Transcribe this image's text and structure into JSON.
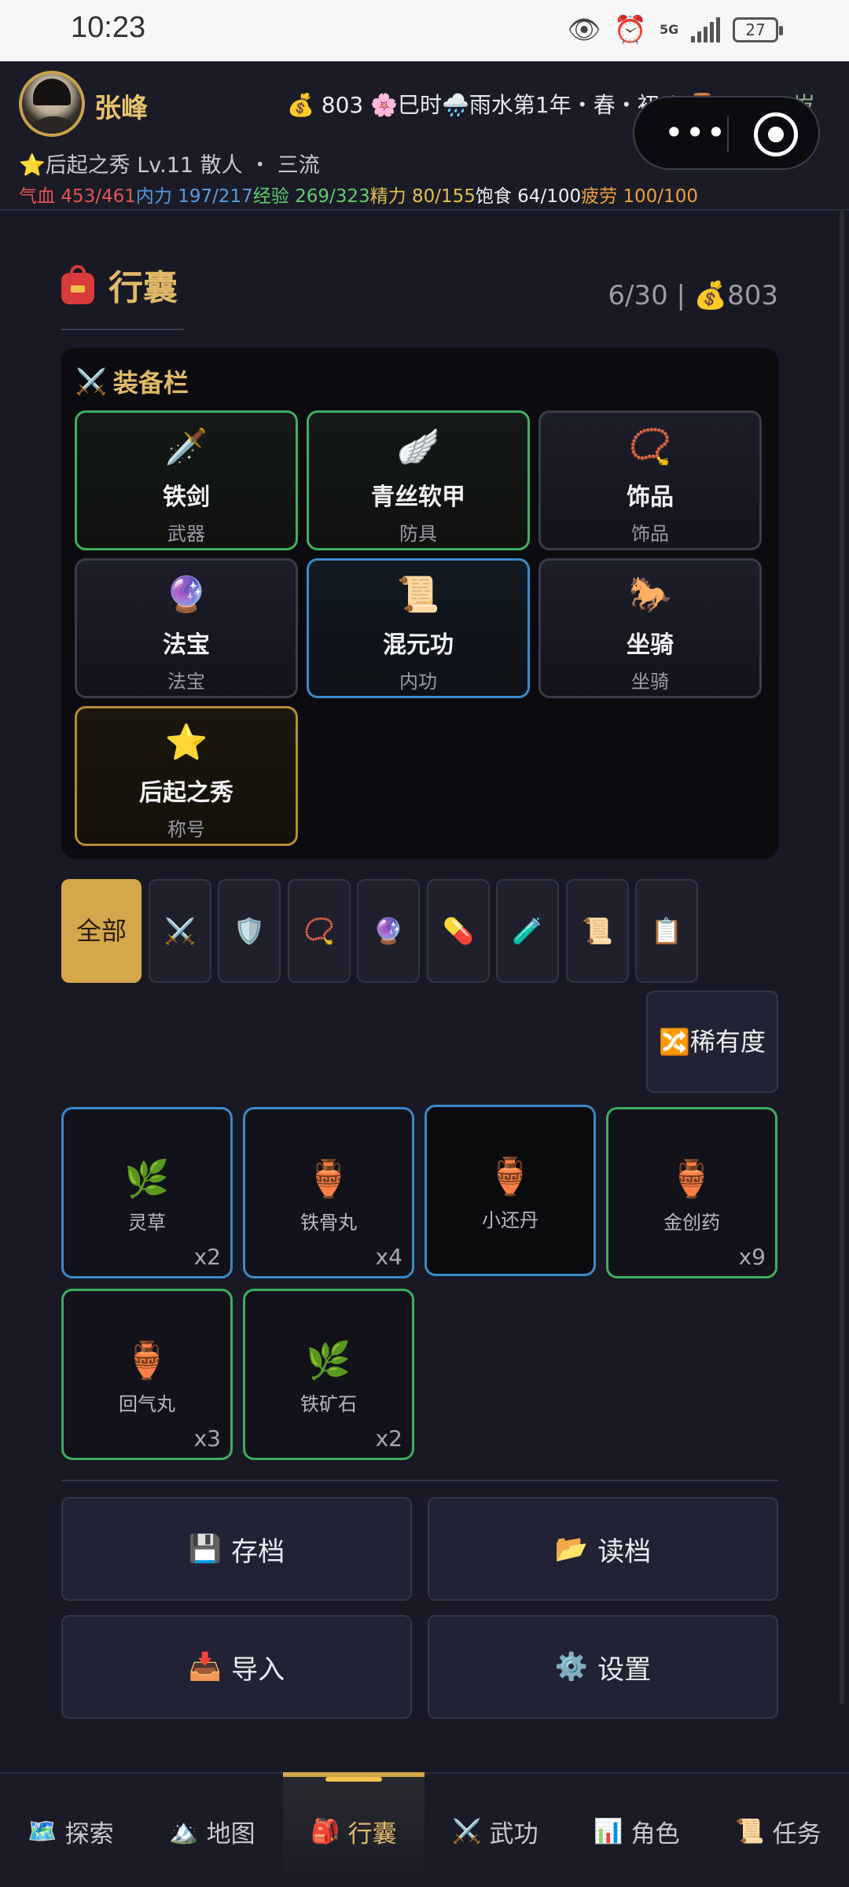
{
  "status_bar": {
    "time": "10:23",
    "network": "5G",
    "battery": "27"
  },
  "header": {
    "player_name": "张峰",
    "gold_icon": "💰",
    "gold": "803",
    "time_period": "🌸巳时",
    "weather_date": "🌧️雨水第1年・春・初八",
    "age": "⌛14/100岁",
    "title_line": "⭐后起之秀 Lv.11 散人 ・ 三流",
    "stats": [
      {
        "label": "气血 ",
        "value": "453/461",
        "color": "#e05656"
      },
      {
        "label": "内力 ",
        "value": "197/217",
        "color": "#5b9ae0"
      },
      {
        "label": "经验 ",
        "value": "269/323",
        "color": "#5fcf6e"
      },
      {
        "label": "精力 ",
        "value": "80/155",
        "color": "#e0c04a"
      },
      {
        "label": "饱食 ",
        "value": "64/100",
        "color": "#f0f0f0"
      },
      {
        "label": "疲劳 ",
        "value": "100/100",
        "color": "#f0a040"
      }
    ]
  },
  "inventory": {
    "title": "行囊",
    "capacity": "6/30 | 💰803",
    "equipment": {
      "title": "装备栏",
      "slots": [
        {
          "icon": "🗡️",
          "name": "铁剑",
          "type": "武器",
          "rarity": "green"
        },
        {
          "icon": "🪽",
          "name": "青丝软甲",
          "type": "防具",
          "rarity": "green"
        },
        {
          "icon": "📿",
          "name": "饰品",
          "type": "饰品",
          "rarity": "empty"
        },
        {
          "icon": "🔮",
          "name": "法宝",
          "type": "法宝",
          "rarity": "empty"
        },
        {
          "icon": "📜",
          "name": "混元功",
          "type": "内功",
          "rarity": "blue"
        },
        {
          "icon": "🐎",
          "name": "坐骑",
          "type": "坐骑",
          "rarity": "empty"
        },
        {
          "icon": "⭐",
          "name": "后起之秀",
          "type": "称号",
          "rarity": "gold"
        }
      ]
    },
    "filters": {
      "all": "全部",
      "icons": [
        "⚔️",
        "🛡️",
        "📿",
        "🔮",
        "💊",
        "🧪",
        "📜",
        "📋"
      ]
    },
    "rarity_sort": "🔀稀有度",
    "items": [
      {
        "icon": "🌿",
        "name": "灵草",
        "qty": "x2",
        "rarity": "blue"
      },
      {
        "icon": "🏺",
        "name": "铁骨丸",
        "qty": "x4",
        "rarity": "blue"
      },
      {
        "icon": "🏺",
        "name": "小还丹",
        "qty": "",
        "rarity": "blue"
      },
      {
        "icon": "🏺",
        "name": "金创药",
        "qty": "x9",
        "rarity": "green"
      },
      {
        "icon": "🏺",
        "name": "回气丸",
        "qty": "x3",
        "rarity": "green"
      },
      {
        "icon": "🌿",
        "name": "铁矿石",
        "qty": "x2",
        "rarity": "green"
      }
    ],
    "actions": {
      "save": {
        "icon": "💾",
        "label": "存档"
      },
      "load": {
        "icon": "📂",
        "label": "读档"
      },
      "import": {
        "icon": "📥",
        "label": "导入"
      },
      "settings": {
        "icon": "⚙️",
        "label": "设置"
      }
    }
  },
  "bottom_nav": [
    {
      "icon": "🗺️",
      "label": "探索"
    },
    {
      "icon": "🏔️",
      "label": "地图"
    },
    {
      "icon": "🎒",
      "label": "行囊"
    },
    {
      "icon": "⚔️",
      "label": "武功"
    },
    {
      "icon": "📊",
      "label": "角色"
    },
    {
      "icon": "📜",
      "label": "任务"
    }
  ]
}
